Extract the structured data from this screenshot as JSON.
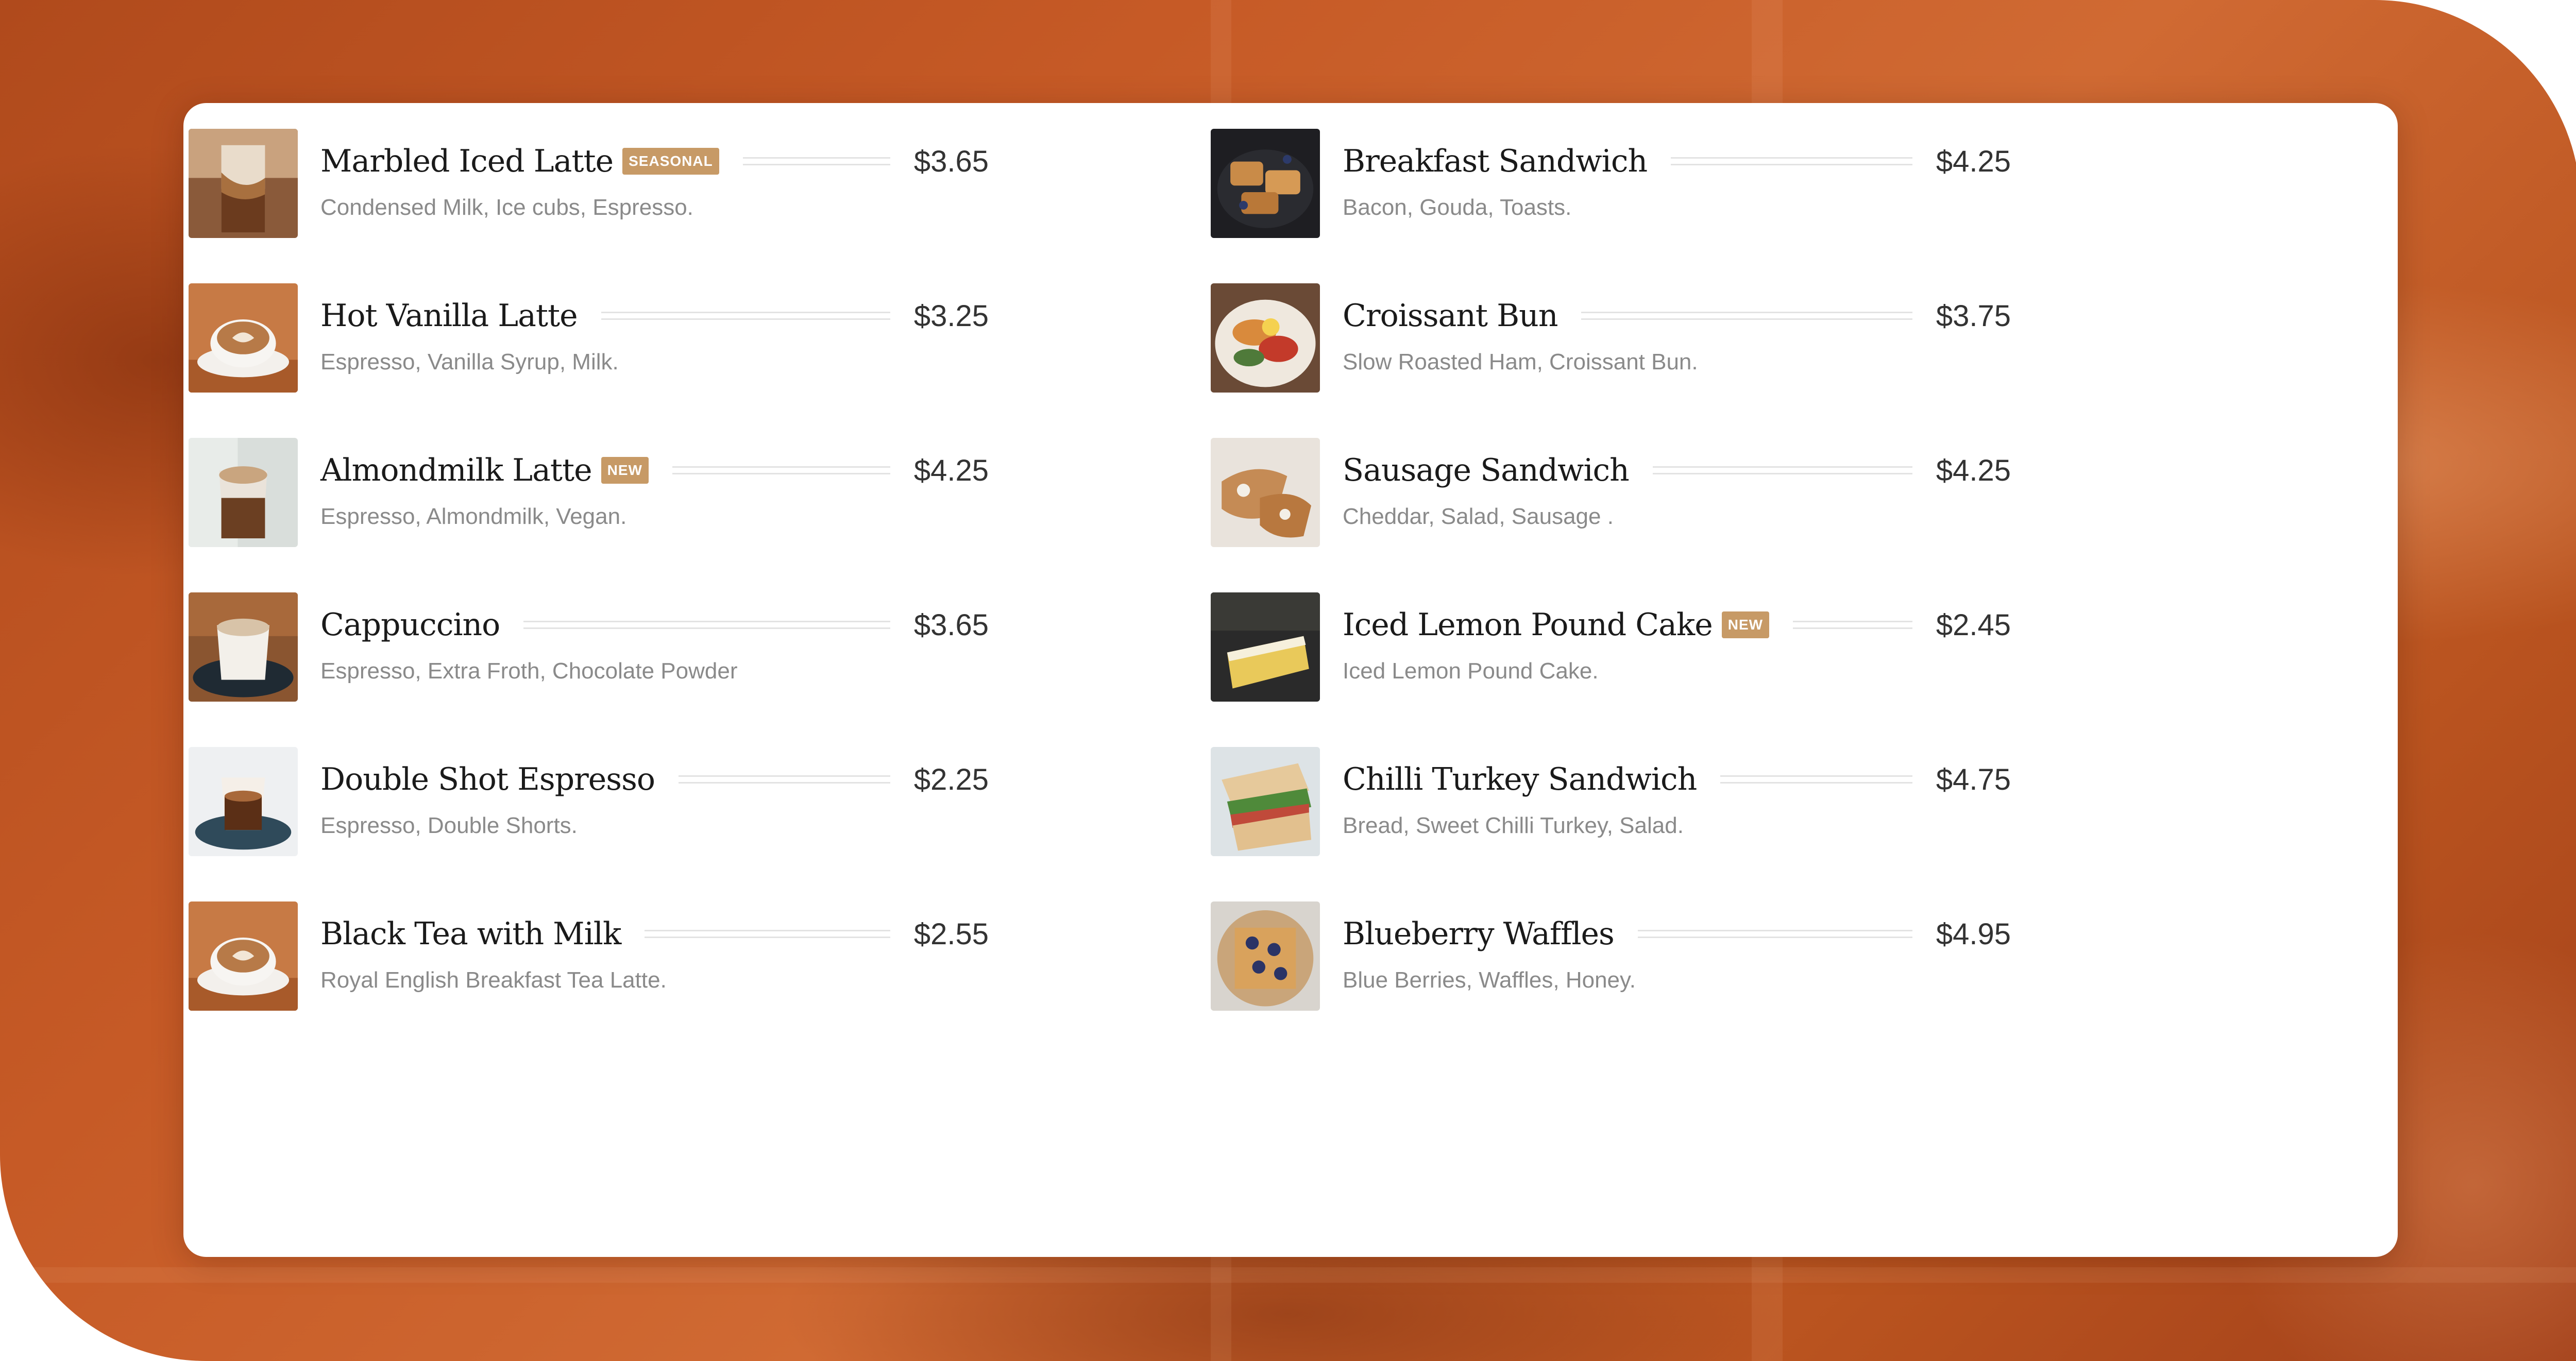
{
  "colors": {
    "background_accent": "#c65a26",
    "card": "#ffffff",
    "badge": "#c79a66",
    "item_name": "#1a1a1a",
    "price": "#333333",
    "description": "#8a8a8a"
  },
  "menu": {
    "left_column": [
      {
        "name": "Marbled Iced Latte",
        "badge": "SEASONAL",
        "price": "$3.65",
        "description": "Condensed Milk, Ice cubs, Espresso.",
        "image_icon": "iced-latte-photo"
      },
      {
        "name": "Hot Vanilla Latte",
        "badge": "",
        "price": "$3.25",
        "description": "Espresso, Vanilla Syrup, Milk.",
        "image_icon": "latte-art-photo"
      },
      {
        "name": "Almondmilk Latte",
        "badge": "NEW",
        "price": "$4.25",
        "description": "Espresso, Almondmilk, Vegan.",
        "image_icon": "almond-latte-photo"
      },
      {
        "name": "Cappuccino",
        "badge": "",
        "price": "$3.65",
        "description": "Espresso, Extra Froth, Chocolate Powder",
        "image_icon": "cappuccino-photo"
      },
      {
        "name": "Double Shot Espresso",
        "badge": "",
        "price": "$2.25",
        "description": "Espresso, Double Shorts.",
        "image_icon": "espresso-photo"
      },
      {
        "name": "Black Tea with Milk",
        "badge": "",
        "price": "$2.55",
        "description": "Royal English Breakfast Tea Latte.",
        "image_icon": "tea-latte-photo"
      }
    ],
    "right_column": [
      {
        "name": "Breakfast Sandwich",
        "badge": "",
        "price": "$4.25",
        "description": "Bacon, Gouda, Toasts.",
        "image_icon": "breakfast-sandwich-photo"
      },
      {
        "name": "Croissant Bun",
        "badge": "",
        "price": "$3.75",
        "description": "Slow Roasted Ham, Croissant Bun.",
        "image_icon": "croissant-bun-photo"
      },
      {
        "name": "Sausage Sandwich",
        "badge": "",
        "price": "$4.25",
        "description": "Cheddar, Salad, Sausage .",
        "image_icon": "sausage-sandwich-photo"
      },
      {
        "name": "Iced Lemon Pound Cake",
        "badge": "NEW",
        "price": "$2.45",
        "description": "Iced Lemon Pound Cake.",
        "image_icon": "pound-cake-photo"
      },
      {
        "name": "Chilli Turkey Sandwich",
        "badge": "",
        "price": "$4.75",
        "description": "Bread, Sweet Chilli Turkey, Salad.",
        "image_icon": "turkey-sandwich-photo"
      },
      {
        "name": "Blueberry Waffles",
        "badge": "",
        "price": "$4.95",
        "description": "Blue Berries, Waffles, Honey.",
        "image_icon": "waffles-photo"
      }
    ]
  }
}
